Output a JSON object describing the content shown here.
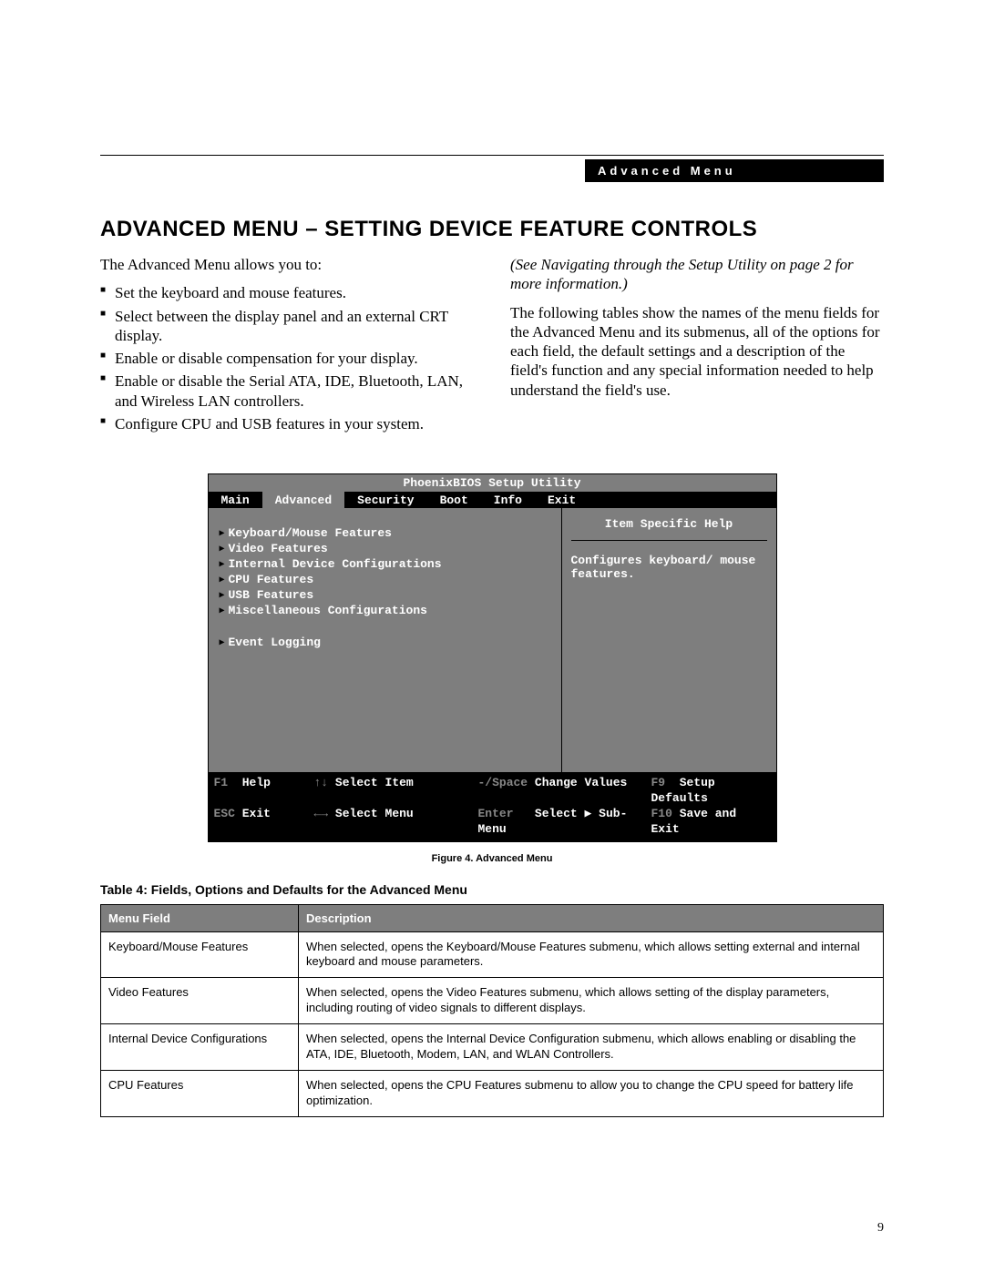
{
  "header_label": "Advanced Menu",
  "doc_title": "ADVANCED MENU – SETTING DEVICE FEATURE CONTROLS",
  "intro": "The Advanced Menu allows you to:",
  "bullets": [
    "Set the keyboard and mouse features.",
    "Select between the display panel and an external CRT display.",
    "Enable or disable compensation for your display.",
    "Enable or disable the Serial ATA, IDE, Bluetooth, LAN, and Wireless LAN controllers.",
    "Configure CPU and USB features in your system."
  ],
  "right_note": "(See Navigating through the Setup Utility on page 2 for more information.)",
  "right_para": "The following tables show the names of the menu fields for the Advanced Menu and its submenus, all of the options for each field, the default settings and a description of the field's function and any special information needed to help understand the field's use.",
  "bios": {
    "title": "PhoenixBIOS Setup Utility",
    "tabs": [
      "Main",
      "Advanced",
      "Security",
      "Boot",
      "Info",
      "Exit"
    ],
    "active_tab": "Advanced",
    "items_a": [
      "Keyboard/Mouse Features",
      "Video Features",
      "Internal Device Configurations",
      "CPU Features",
      "USB Features",
      "Miscellaneous Configurations"
    ],
    "items_b": [
      "Event Logging"
    ],
    "help_title": "Item Specific Help",
    "help_text": "Configures keyboard/ mouse features.",
    "footer": {
      "r1": {
        "k1": "F1",
        "l1": "Help",
        "k2": "↑↓",
        "l2": "Select Item",
        "k3": "-/Space",
        "l3": "Change Values",
        "k4": "F9",
        "l4": "Setup Defaults"
      },
      "r2": {
        "k1": "ESC",
        "l1": "Exit",
        "k2": "←→",
        "l2": "Select Menu",
        "k3": "Enter",
        "l3": "Select ▶ Sub-Menu",
        "k4": "F10",
        "l4": "Save and Exit"
      }
    }
  },
  "figure_caption": "Figure 4.  Advanced Menu",
  "table_caption": "Table 4: Fields, Options and Defaults for the Advanced Menu",
  "table_headers": {
    "col1": "Menu Field",
    "col2": "Description"
  },
  "table_rows": [
    {
      "field": "Keyboard/Mouse Features",
      "desc": "When selected, opens the Keyboard/Mouse Features submenu, which allows setting external and internal keyboard and mouse parameters."
    },
    {
      "field": "Video Features",
      "desc": "When selected, opens the Video Features submenu, which allows setting of the display parameters, including routing of video signals to different displays."
    },
    {
      "field": "Internal Device Configurations",
      "desc": "When selected, opens the Internal Device Configuration submenu, which allows enabling or disabling the ATA, IDE, Bluetooth, Modem, LAN, and WLAN Controllers."
    },
    {
      "field": "CPU Features",
      "desc": "When selected, opens the CPU Features submenu to allow you to change the CPU speed for battery life optimization."
    }
  ],
  "page_number": "9"
}
